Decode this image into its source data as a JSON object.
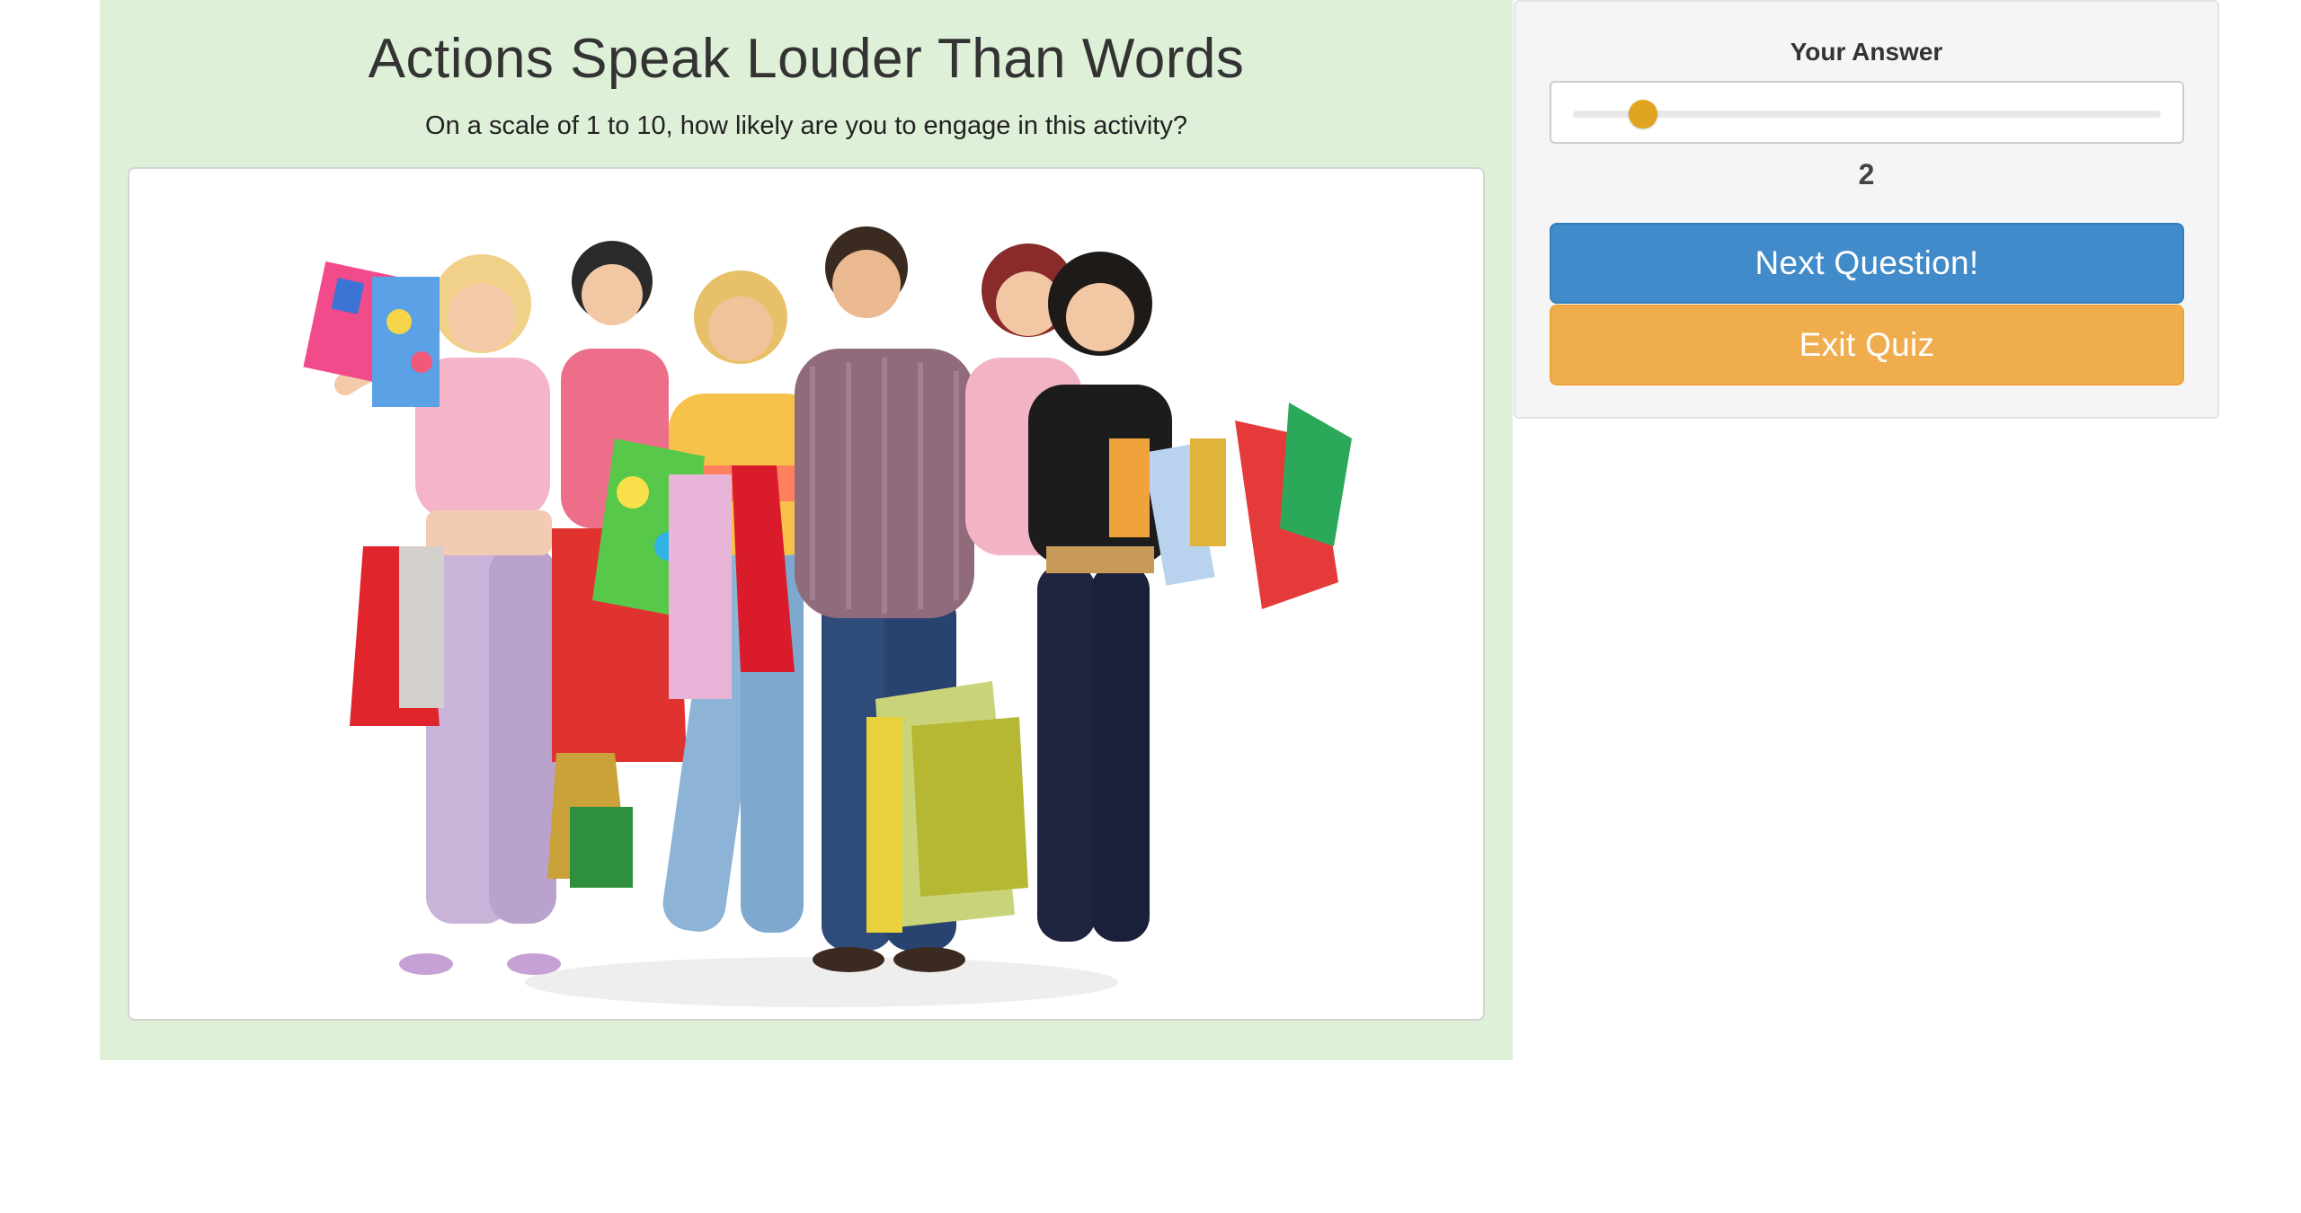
{
  "question": {
    "title": "Actions Speak Louder Than Words",
    "subtitle": "On a scale of 1 to 10, how likely are you to engage in this activity?",
    "image": "photo-group-of-shoppers-with-colorful-bags"
  },
  "answer": {
    "heading": "Your Answer",
    "slider": {
      "min": 1,
      "max": 10,
      "value": 2
    },
    "value_display": "2"
  },
  "buttons": {
    "next_label": "Next Question!",
    "exit_label": "Exit Quiz"
  },
  "colors": {
    "question_panel_bg": "#dff0d8",
    "answer_panel_bg": "#f5f5f5",
    "next_button": "#428bca",
    "exit_button": "#f0ad4e",
    "slider_thumb": "#e0a420"
  }
}
